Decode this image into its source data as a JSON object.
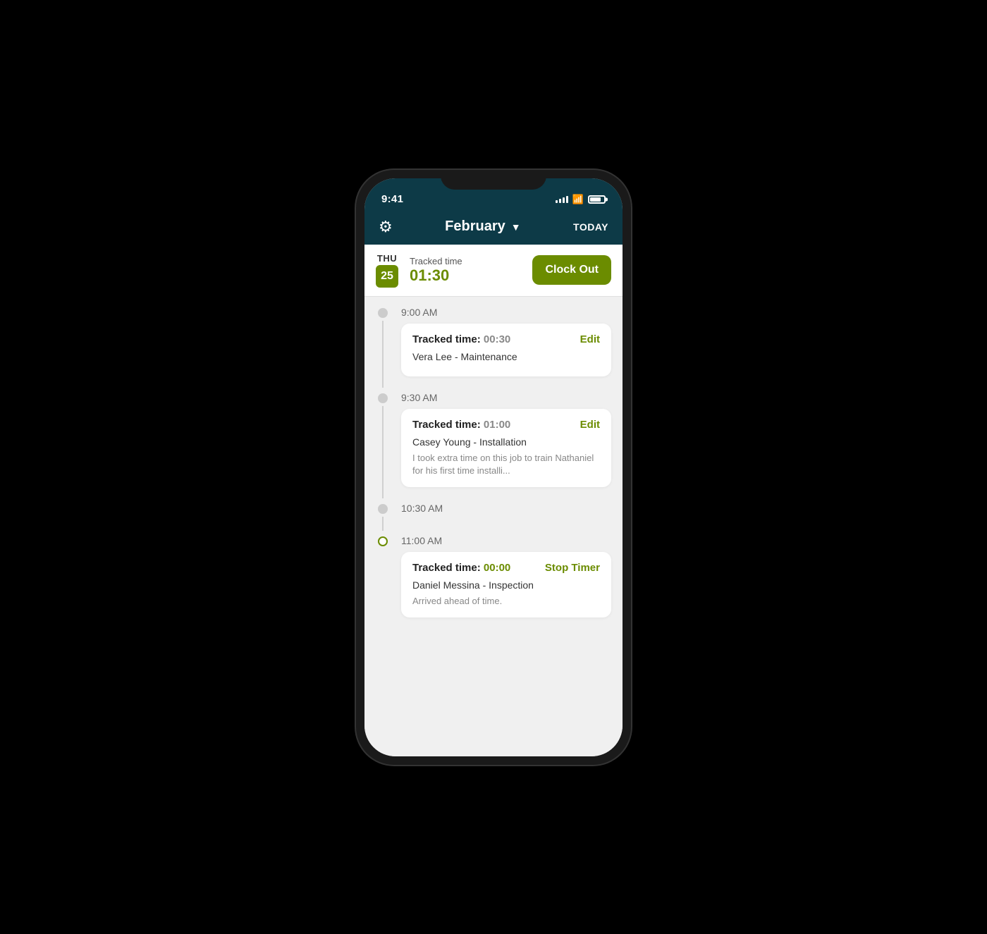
{
  "status_bar": {
    "time": "9:41",
    "battery_level": 80
  },
  "header": {
    "gear_label": "⚙",
    "month": "February",
    "chevron": "ᐯ",
    "today_label": "TODAY"
  },
  "day_header": {
    "day_name": "THU",
    "day_number": "25",
    "tracked_label": "Tracked time",
    "tracked_value": "01:30",
    "clock_out_label": "Clock Out"
  },
  "timeline": [
    {
      "time": "9:00 AM",
      "dot_active": false,
      "card": {
        "tracked_prefix": "Tracked time:",
        "tracked_time": " 00:30",
        "action_label": "Edit",
        "person": "Vera Lee - Maintenance",
        "note": null
      }
    },
    {
      "time": "9:30 AM",
      "dot_active": false,
      "card": {
        "tracked_prefix": "Tracked time:",
        "tracked_time": " 01:00",
        "action_label": "Edit",
        "person": "Casey Young - Installation",
        "note": "I took extra time on this job to train Nathaniel for his first time installi..."
      }
    },
    {
      "time": "10:30 AM",
      "dot_active": false,
      "card": null
    },
    {
      "time": "11:00 AM",
      "dot_active": true,
      "card": {
        "tracked_prefix": "Tracked time:",
        "tracked_time": " 00:00",
        "action_label": "Stop Timer",
        "person": "Daniel Messina - Inspection",
        "note": "Arrived ahead of time."
      }
    }
  ]
}
